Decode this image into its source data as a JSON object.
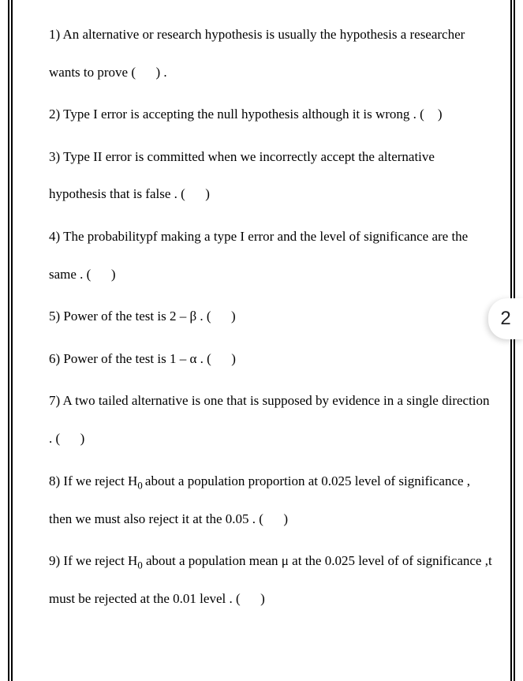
{
  "page_tab": "2",
  "questions": [
    {
      "num": "1)",
      "text": "An alternative or research hypothesis is usually the hypothesis a researcher wants to prove (   ) ."
    },
    {
      "num": "2)",
      "text": "Type I error is accepting the null hypothesis although it is wrong . (  )"
    },
    {
      "num": "3)",
      "text": "Type II error is committed when we incorrectly accept the alternative hypothesis that is false . (   )"
    },
    {
      "num": "4)",
      "text": "The probabilitypf making a type I error and the level of significance are the same . (   )"
    },
    {
      "num": "5)",
      "text": "Power of the test is 2 – β . (   )"
    },
    {
      "num": "6)",
      "text": "Power of the test is 1 – α . (   )"
    },
    {
      "num": "7)",
      "text": "A two tailed alternative is one that is supposed by evidence in a single direction . (   )"
    },
    {
      "num": "8)",
      "text_html": "If we reject H<sub>0 </sub>about a population proportion at 0.025 level of significance , then we must also reject it at the 0.05 . (   )"
    },
    {
      "num": "9)",
      "text_html": "If we reject H<sub>0</sub> about a population mean μ at the 0.025 level of of significance ,t must be rejected at the 0.01 level . (   )"
    }
  ]
}
